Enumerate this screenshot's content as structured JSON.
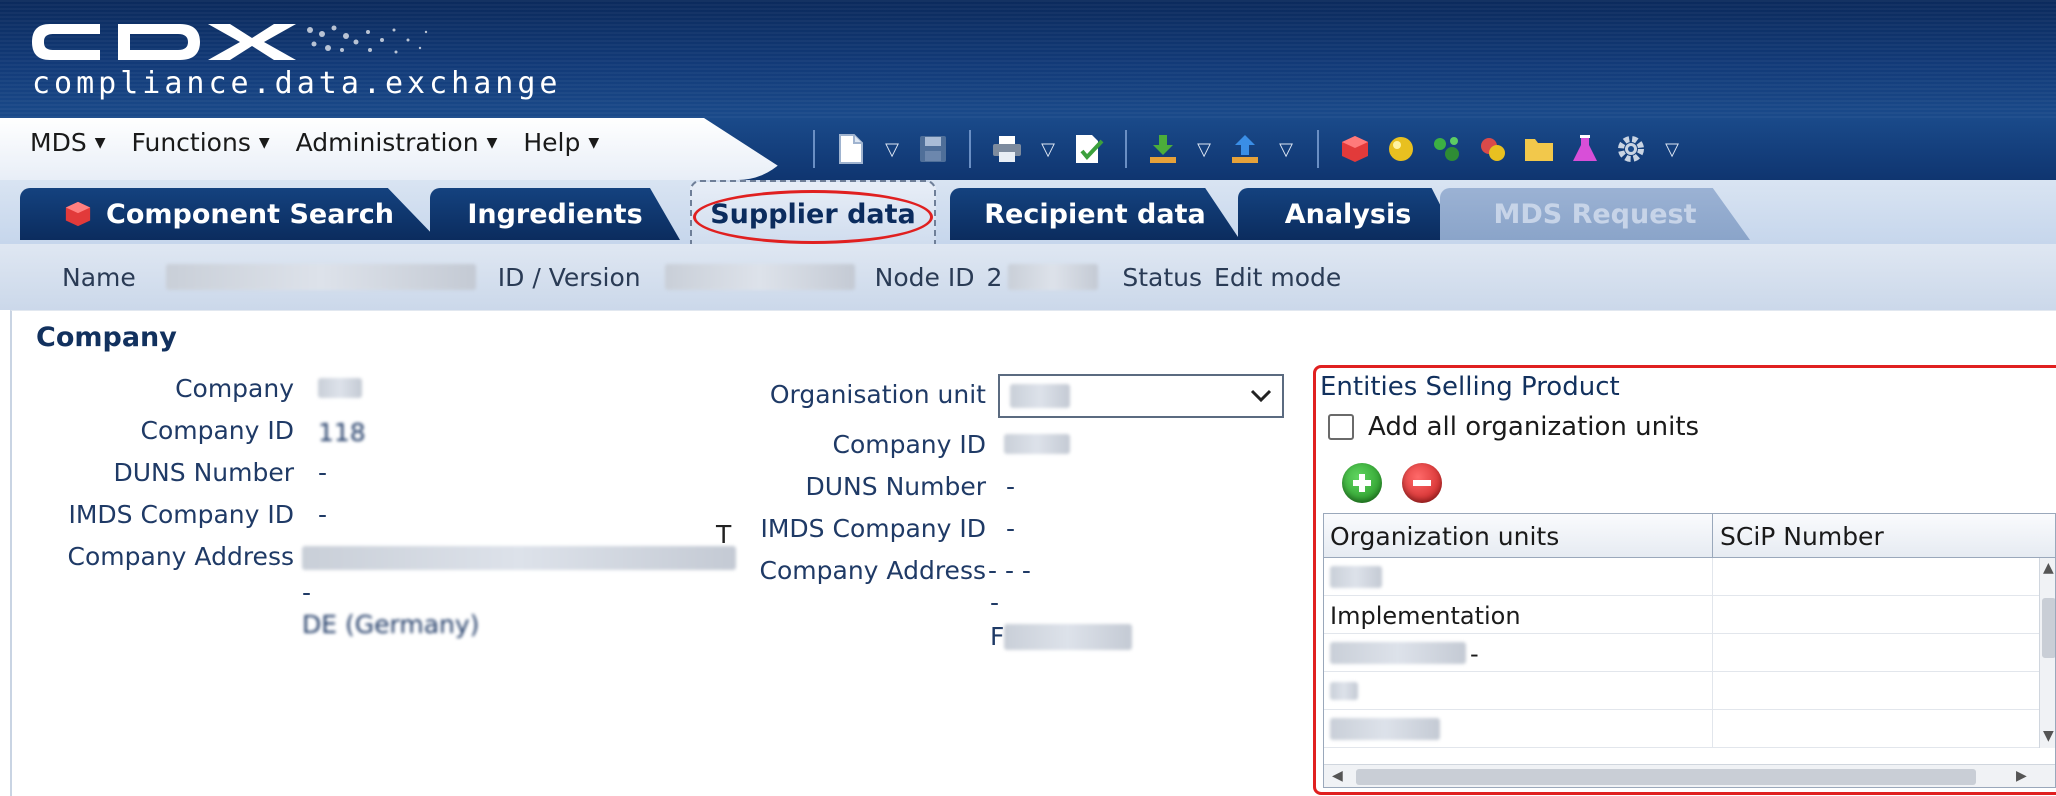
{
  "header": {
    "logo_text": "CDX",
    "tagline": "compliance.data.exchange"
  },
  "menu": [
    {
      "label": "MDS"
    },
    {
      "label": "Functions"
    },
    {
      "label": "Administration"
    },
    {
      "label": "Help"
    }
  ],
  "toolbar": {
    "icons": [
      "new-document-icon",
      "save-icon",
      "print-icon",
      "check-document-icon",
      "download-icon",
      "upload-icon",
      "red-cube-icon",
      "yellow-sphere-icon",
      "molecule-icon",
      "substance-icon",
      "folder-icon",
      "flask-icon",
      "gear-icon"
    ]
  },
  "tabs": [
    {
      "label": "Component Search",
      "state": "normal"
    },
    {
      "label": "Ingredients",
      "state": "normal"
    },
    {
      "label": "Supplier data",
      "state": "active"
    },
    {
      "label": "Recipient data",
      "state": "normal"
    },
    {
      "label": "Analysis",
      "state": "normal"
    },
    {
      "label": "MDS Request",
      "state": "disabled"
    }
  ],
  "infobar": {
    "name_label": "Name",
    "id_version_label": "ID / Version",
    "node_id_label": "Node ID",
    "node_id_value": "2",
    "status_label": "Status",
    "status_value": "Edit mode"
  },
  "company_section": {
    "title": "Company",
    "left": {
      "company_label": "Company",
      "company_id_label": "Company ID",
      "company_id_value": "118",
      "duns_label": "DUNS Number",
      "duns_value": "-",
      "imds_label": "IMDS Company ID",
      "imds_value": "-",
      "address_label": "Company Address",
      "address_line2": "-",
      "address_line3": "DE (Germany)"
    },
    "right": {
      "org_unit_label": "Organisation unit",
      "company_id_label": "Company ID",
      "duns_label": "DUNS Number",
      "duns_value": "-",
      "imds_label": "IMDS Company ID",
      "imds_value": "-",
      "address_label": "Company Address",
      "address_value": "- - -",
      "address_line2": "-",
      "address_line3": "F"
    },
    "cursor_glyph": "T"
  },
  "entities": {
    "title": "Entities Selling Product",
    "add_all_label": "Add all organization units",
    "add_all_checked": false,
    "columns": [
      "Organization units",
      "SCiP Number"
    ],
    "rows": [
      {
        "unit": "",
        "scip": ""
      },
      {
        "unit": "Implementation",
        "scip": ""
      },
      {
        "unit": "-",
        "scip": ""
      },
      {
        "unit": "",
        "scip": ""
      },
      {
        "unit": "",
        "scip": ""
      }
    ]
  },
  "colors": {
    "brand_dark": "#0b2c5e",
    "highlight": "#e02020",
    "label_text": "#1f3a66"
  }
}
